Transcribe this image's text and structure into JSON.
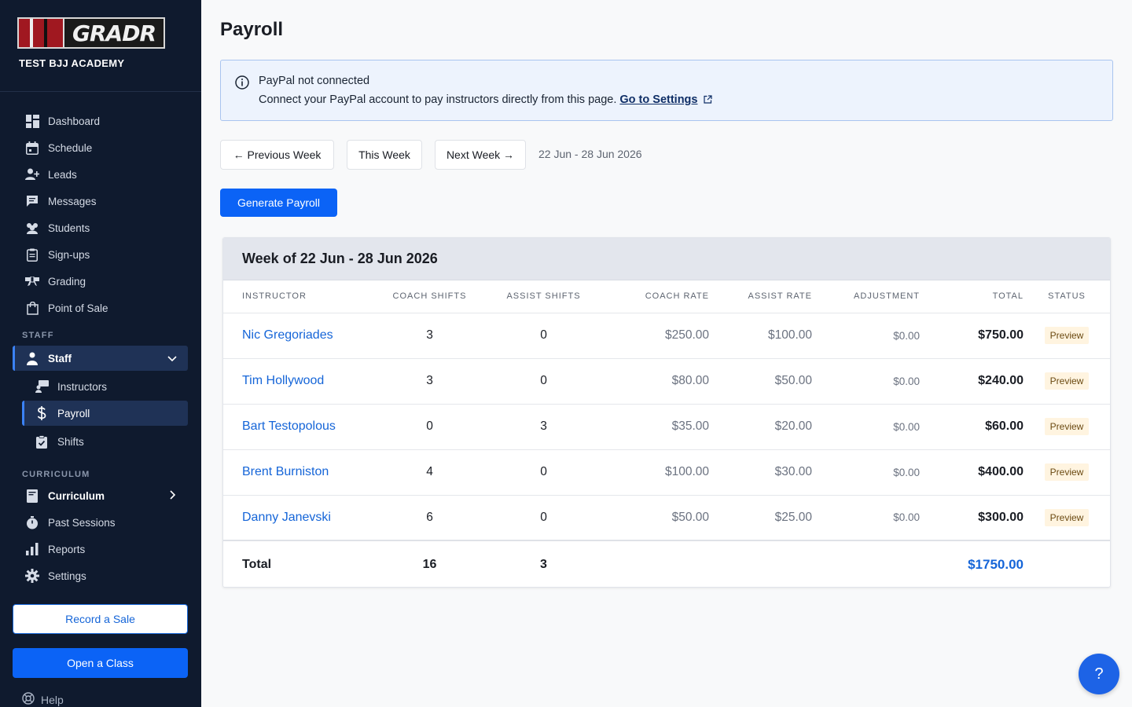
{
  "brand": {
    "logo_text": "GRADR",
    "academy": "TEST BJJ ACADEMY"
  },
  "sidebar": {
    "items": [
      {
        "label": "Dashboard",
        "icon": "dashboard-icon"
      },
      {
        "label": "Schedule",
        "icon": "calendar-icon"
      },
      {
        "label": "Leads",
        "icon": "add-user-icon"
      },
      {
        "label": "Messages",
        "icon": "message-icon"
      },
      {
        "label": "Students",
        "icon": "students-icon"
      },
      {
        "label": "Sign-ups",
        "icon": "clipboard-icon"
      },
      {
        "label": "Grading",
        "icon": "belt-icon"
      },
      {
        "label": "Point of Sale",
        "icon": "shopping-bag-icon"
      }
    ],
    "staff_section": "STAFF",
    "staff_label": "Staff",
    "staff_sub": [
      {
        "label": "Instructors"
      },
      {
        "label": "Payroll"
      },
      {
        "label": "Shifts"
      }
    ],
    "curriculum_section": "CURRICULUM",
    "curriculum_label": "Curriculum",
    "more_items": [
      {
        "label": "Past Sessions"
      },
      {
        "label": "Reports"
      },
      {
        "label": "Settings"
      }
    ],
    "record_sale": "Record a Sale",
    "open_class": "Open a Class",
    "help": "Help"
  },
  "page": {
    "title": "Payroll",
    "alert": {
      "title": "PayPal not connected",
      "body": "Connect your PayPal account to pay instructors directly from this page.",
      "link": "Go to Settings"
    },
    "prev_week": "← Previous Week",
    "this_week": "This Week",
    "next_week": "Next Week →",
    "range": "22 Jun - 28 Jun 2026",
    "generate": "Generate Payroll"
  },
  "table": {
    "heading": "Week of 22 Jun - 28 Jun 2026",
    "columns": [
      "INSTRUCTOR",
      "COACH SHIFTS",
      "ASSIST SHIFTS",
      "COACH RATE",
      "ASSIST RATE",
      "ADJUSTMENT",
      "TOTAL",
      "STATUS"
    ],
    "rows": [
      {
        "name": "Nic Gregoriades",
        "coach": "3",
        "assist": "0",
        "coach_rate": "$250.00",
        "assist_rate": "$100.00",
        "adj": "$0.00",
        "total": "$750.00",
        "status": "Preview"
      },
      {
        "name": "Tim Hollywood",
        "coach": "3",
        "assist": "0",
        "coach_rate": "$80.00",
        "assist_rate": "$50.00",
        "adj": "$0.00",
        "total": "$240.00",
        "status": "Preview"
      },
      {
        "name": "Bart Testopolous",
        "coach": "0",
        "assist": "3",
        "coach_rate": "$35.00",
        "assist_rate": "$20.00",
        "adj": "$0.00",
        "total": "$60.00",
        "status": "Preview"
      },
      {
        "name": "Brent Burniston",
        "coach": "4",
        "assist": "0",
        "coach_rate": "$100.00",
        "assist_rate": "$30.00",
        "adj": "$0.00",
        "total": "$400.00",
        "status": "Preview"
      },
      {
        "name": "Danny Janevski",
        "coach": "6",
        "assist": "0",
        "coach_rate": "$50.00",
        "assist_rate": "$25.00",
        "adj": "$0.00",
        "total": "$300.00",
        "status": "Preview"
      }
    ],
    "total_label": "Total",
    "total_coach": "16",
    "total_assist": "3",
    "grand_total": "$1750.00"
  },
  "fab": "?",
  "colors": {
    "sidebar_bg": "#0f1a2e",
    "accent": "#0b63f6",
    "link": "#1565d8"
  }
}
